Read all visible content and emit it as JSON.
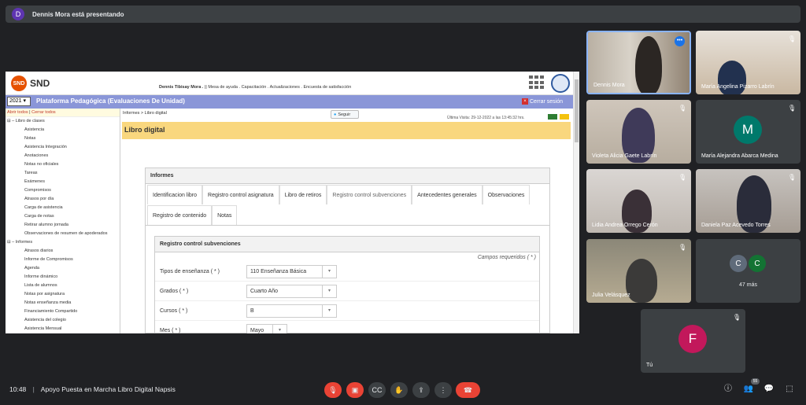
{
  "banner": {
    "avatar_letter": "D",
    "text": "Dennis Mora está presentando"
  },
  "screen": {
    "app_name": "SND",
    "app_logo_text": "SND",
    "user": "Dennis Tibisay Mora .",
    "topnav": "|| Mesa de ayuda . Capacitación . Actualizaciones . Encuesta de satisfacción",
    "year": "2021",
    "platform_title": "Plataforma Pedagógica (Evaluaciones De Unidad)",
    "logout": "Cerrar sesión",
    "tree_open": "Abrir todos",
    "tree_sep": " | ",
    "tree_close": "Cerrar todos",
    "sidebar": [
      {
        "type": "group",
        "label": "Libro de clases"
      },
      {
        "type": "item",
        "label": "Asistencia"
      },
      {
        "type": "item",
        "label": "Notas"
      },
      {
        "type": "item",
        "label": "Asistencia Integración"
      },
      {
        "type": "item",
        "label": "Anotaciones"
      },
      {
        "type": "item",
        "label": "Notas no oficiales"
      },
      {
        "type": "item",
        "label": "Tareas"
      },
      {
        "type": "item",
        "label": "Exámenes"
      },
      {
        "type": "item",
        "label": "Compromisos"
      },
      {
        "type": "item",
        "label": "Atrasos por día"
      },
      {
        "type": "item",
        "label": "Carga de asistencia"
      },
      {
        "type": "item",
        "label": "Carga de notas"
      },
      {
        "type": "item",
        "label": "Retirar alumno jornada"
      },
      {
        "type": "item",
        "label": "Observaciones de resumen de apoderados"
      },
      {
        "type": "group",
        "label": "Informes"
      },
      {
        "type": "item",
        "label": "Atrasos diarios"
      },
      {
        "type": "item",
        "label": "Informe de Compromisos"
      },
      {
        "type": "item",
        "label": "Agenda"
      },
      {
        "type": "item",
        "label": "Informe dinámico"
      },
      {
        "type": "item",
        "label": "Lista de alumnos"
      },
      {
        "type": "item",
        "label": "Notas por asignatura"
      },
      {
        "type": "item",
        "label": "Notas enseñanza media"
      },
      {
        "type": "item",
        "label": "Financiamiento Compartido"
      },
      {
        "type": "item",
        "label": "Asistencia del colegio"
      },
      {
        "type": "item",
        "label": "Asistencia Mensual"
      }
    ],
    "breadcrumb": "Informes > Libro digital",
    "follow_label": "Seguir",
    "last_visit": "Última Visita: 29-12-2022 a las 13:45:32 hrs.",
    "page_title": "Libro digital",
    "panel_title": "Informes",
    "tabs": [
      "Identificacion libro",
      "Registro control asignatura",
      "Libro de retiros",
      "Registro control subvenciones",
      "Antecedentes generales",
      "Observaciones",
      "Registro de contenido",
      "Notas"
    ],
    "inner_title": "Registro control subvenciones",
    "required_note": "Campos requeridos ( * )",
    "fields": [
      {
        "label": "Tipos de enseñanza ( * )",
        "value": "110 Enseñanza Básica"
      },
      {
        "label": "Grados ( * )",
        "value": "Cuarto Año"
      },
      {
        "label": "Cursos ( * )",
        "value": "B"
      },
      {
        "label": "Mes ( * )",
        "value": "Mayo"
      }
    ]
  },
  "participants": [
    {
      "name": "Dennis Mora",
      "type": "video"
    },
    {
      "name": "María Angelina Pizarro Labrín",
      "type": "video"
    },
    {
      "name": "Violeta Alicia Gaete Labrín",
      "type": "video"
    },
    {
      "name": "María Alejandra Abarca Medina",
      "type": "avatar",
      "letter": "M",
      "color": "#00796b"
    },
    {
      "name": "Lidia Andrea Orrego Cerón",
      "type": "video"
    },
    {
      "name": "Daniela Paz Acevedo Torres",
      "type": "video"
    },
    {
      "name": "Julia Velásquez",
      "type": "video"
    },
    {
      "name": "47 más",
      "type": "more",
      "letters": [
        "C",
        "C"
      ],
      "colors": [
        "#5f6b7a",
        "#137333"
      ]
    },
    {
      "name": "Tú",
      "type": "avatar",
      "letter": "F",
      "color": "#c2185b"
    }
  ],
  "bottom": {
    "time": "10:48",
    "meeting_title": "Apoyo Puesta en Marcha Libro Digital Napsis",
    "people_count": "55",
    "mic_icon": "mic-off-icon",
    "cam_icon": "camera-off-icon",
    "cc_icon": "captions-icon",
    "hand_icon": "raise-hand-icon",
    "present_icon": "present-icon",
    "more_icon": "more-options-icon",
    "end_icon": "end-call-icon",
    "info_icon": "info-icon",
    "people_icon": "people-icon",
    "chat_icon": "chat-icon",
    "activities_icon": "activities-icon"
  },
  "colors": {
    "meet_bg": "#202124",
    "tile_bg": "#3c4043",
    "red": "#ea4335",
    "snd_blue": "#8a96d8",
    "title_yellow": "#f9d77e"
  }
}
